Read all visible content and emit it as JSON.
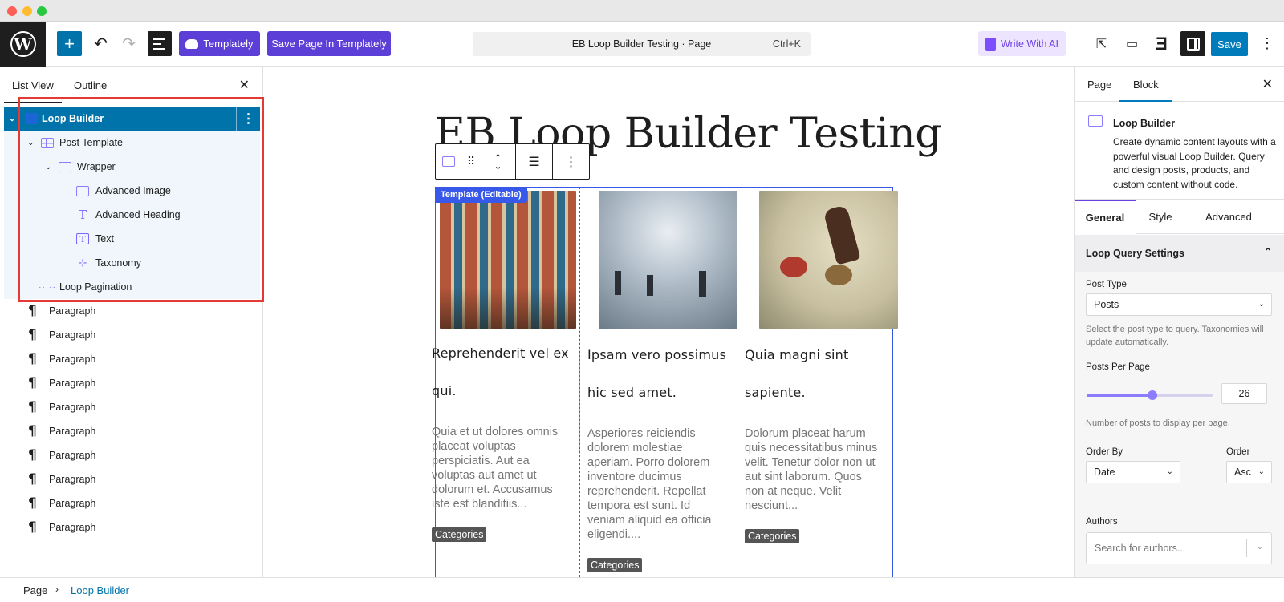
{
  "toolbar": {
    "wp_logo": "W",
    "templately_label": "Templately",
    "save_templately_label": "Save Page In Templately",
    "command_title": "EB Loop Builder Testing · Page",
    "command_shortcut": "Ctrl+K",
    "write_ai_label": "Write With AI",
    "save_label": "Save",
    "icons": [
      "add-icon",
      "undo-icon",
      "redo-icon",
      "document-overview-icon",
      "external-link-icon",
      "device-preview-icon",
      "essential-blocks-icon",
      "settings-panel-icon",
      "more-options-icon"
    ]
  },
  "list_view": {
    "tabs": [
      "List View",
      "Outline"
    ],
    "tree": [
      {
        "label": "Loop Builder",
        "level": 0,
        "icon": "loop-builder-icon"
      },
      {
        "label": "Post Template",
        "level": 1,
        "icon": "post-template-icon"
      },
      {
        "label": "Wrapper",
        "level": 2,
        "icon": "wrapper-icon"
      },
      {
        "label": "Advanced Image",
        "level": 3,
        "icon": "image-icon"
      },
      {
        "label": "Advanced Heading",
        "level": 3,
        "icon": "heading-icon"
      },
      {
        "label": "Text",
        "level": 3,
        "icon": "text-icon"
      },
      {
        "label": "Taxonomy",
        "level": 3,
        "icon": "taxonomy-icon"
      },
      {
        "label": "Loop Pagination",
        "level": 1,
        "icon": "pagination-icon"
      }
    ],
    "paragraphs": [
      "Paragraph",
      "Paragraph",
      "Paragraph",
      "Paragraph",
      "Paragraph",
      "Paragraph",
      "Paragraph",
      "Paragraph",
      "Paragraph",
      "Paragraph"
    ]
  },
  "canvas": {
    "page_title": "EB Loop Builder Testing",
    "template_tag": "Template (Editable)",
    "posts": [
      {
        "title_line1": "Reprehenderit vel ex",
        "title_line2": "qui.",
        "excerpt": "Quia et ut dolores omnis placeat voluptas perspiciatis. Aut ea voluptas aut amet ut dolorum et. Accusamus iste est blanditiis...",
        "category": "Categories"
      },
      {
        "title_line1": "Ipsam vero possimus",
        "title_line2": "hic sed amet.",
        "excerpt": "Asperiores reiciendis dolorem molestiae aperiam. Porro dolorem inventore ducimus reprehenderit. Repellat tempora est sunt. Id veniam aliquid ea officia eligendi....",
        "category": "Categories"
      },
      {
        "title_line1": "Quia magni sint",
        "title_line2": "sapiente.",
        "excerpt": "Dolorum placeat harum quis necessitatibus minus velit. Tenetur dolor non ut aut sint laborum. Quos non at neque. Velit nesciunt...",
        "category": "Categories"
      }
    ]
  },
  "settings": {
    "tabs": [
      "Page",
      "Block"
    ],
    "block_title": "Loop Builder",
    "block_desc": "Create dynamic content layouts with a powerful visual Loop Builder. Query and design posts, products, and custom content without code.",
    "setting_tabs": [
      "General",
      "Style",
      "Advanced"
    ],
    "section_title": "Loop Query Settings",
    "post_type_label": "Post Type",
    "post_type_value": "Posts",
    "post_type_help": "Select the post type to query. Taxonomies will update automatically.",
    "per_page_label": "Posts Per Page",
    "per_page_value": "26",
    "per_page_slider_fraction": 0.52,
    "per_page_help": "Number of posts to display per page.",
    "order_by_label": "Order By",
    "order_by_value": "Date",
    "order_label": "Order",
    "order_value": "Asc",
    "authors_label": "Authors",
    "authors_placeholder": "Search for authors..."
  },
  "breadcrumb": {
    "page": "Page",
    "current": "Loop Builder"
  },
  "colors": {
    "wp_blue": "#0073aa",
    "templately_purple": "#5b3fd6",
    "selection_blue": "#3858e9",
    "highlight_red": "#e53935"
  }
}
